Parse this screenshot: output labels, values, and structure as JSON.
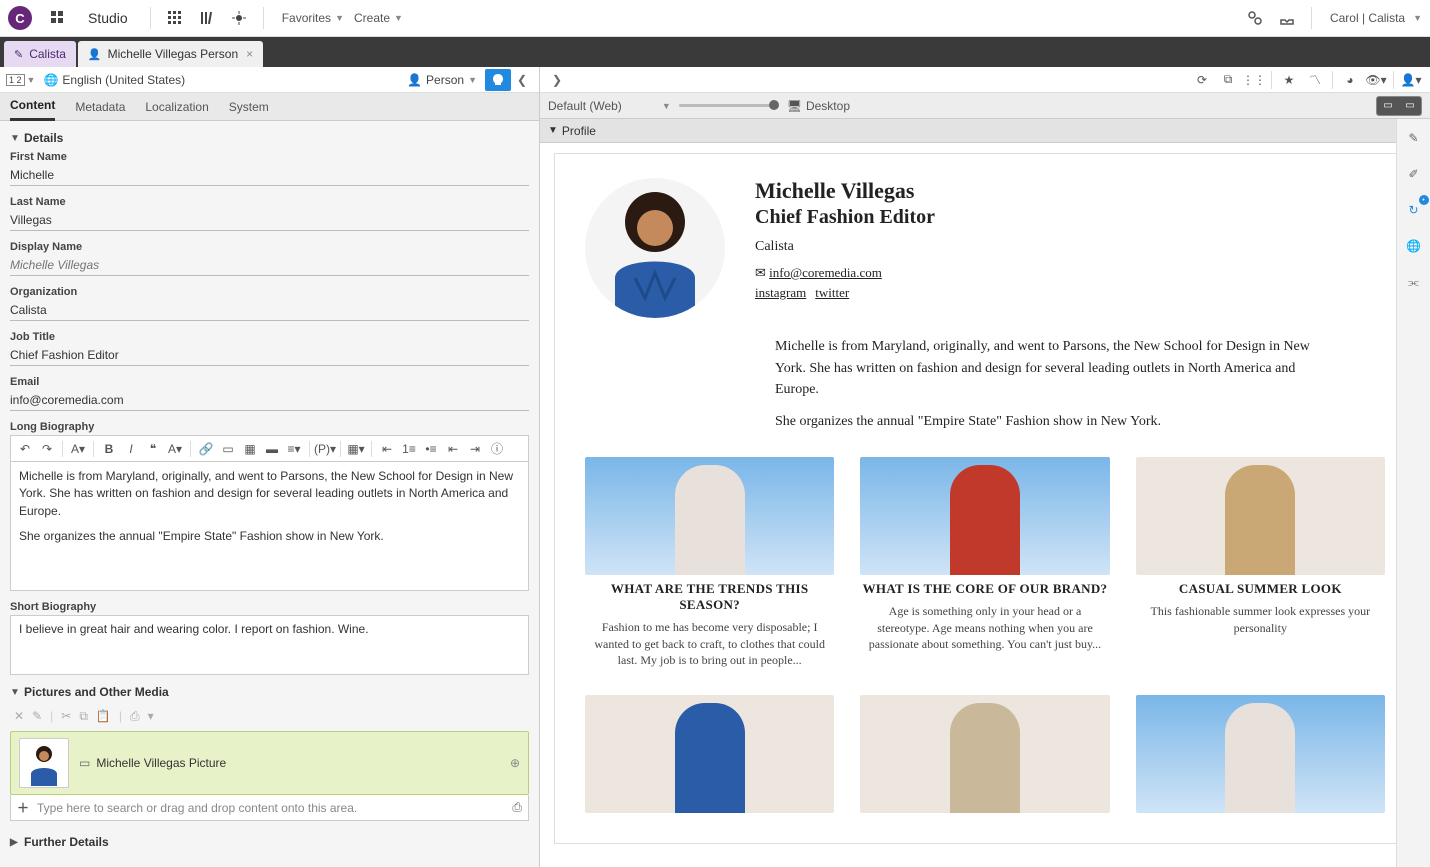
{
  "topbar": {
    "app_title": "Studio",
    "favorites_label": "Favorites",
    "create_label": "Create",
    "user_label": "Carol | Calista"
  },
  "tabs": {
    "site": "Calista",
    "doc": "Michelle Villegas Person"
  },
  "left_toolbar": {
    "locale": "English (United States)",
    "type": "Person"
  },
  "subtabs": [
    "Content",
    "Metadata",
    "Localization",
    "System"
  ],
  "sections": {
    "details": "Details",
    "pictures": "Pictures and Other Media",
    "further": "Further Details"
  },
  "fields": {
    "first_name": {
      "label": "First Name",
      "value": "Michelle"
    },
    "last_name": {
      "label": "Last Name",
      "value": "Villegas"
    },
    "display_name": {
      "label": "Display Name",
      "placeholder": "Michelle Villegas"
    },
    "organization": {
      "label": "Organization",
      "value": "Calista"
    },
    "job_title": {
      "label": "Job Title",
      "value": "Chief Fashion Editor"
    },
    "email": {
      "label": "Email",
      "value": "info@coremedia.com"
    },
    "long_bio": {
      "label": "Long Biography",
      "p1": "Michelle is from Maryland, originally, and went to Parsons, the New School for Design in New York. She has written on fashion and design for several leading outlets in North America and Europe.",
      "p2": "She organizes the annual \"Empire State\" Fashion show in New York."
    },
    "short_bio": {
      "label": "Short Biography",
      "value": "I believe in great hair and wearing color. I report on fashion. Wine."
    }
  },
  "media": {
    "item_label": "Michelle Villegas Picture",
    "drop_hint": "Type here to search or drag and drop content onto this area."
  },
  "preview_strip": {
    "channel": "Default (Web)",
    "device": "Desktop"
  },
  "profile_section": "Profile",
  "preview": {
    "name": "Michelle Villegas",
    "title": "Chief Fashion Editor",
    "org": "Calista",
    "email": "info@coremedia.com",
    "social": {
      "instagram": "instagram",
      "twitter": "twitter"
    },
    "bio_p1": "Michelle is from Maryland, originally, and went to Parsons, the New School for Design in New York. She has written on fashion and design for several leading outlets in North America and Europe.",
    "bio_p2": "She organizes the annual \"Empire State\" Fashion show in New York."
  },
  "articles": [
    {
      "title": "WHAT ARE THE TRENDS THIS SEASON?",
      "desc": "Fashion to me has become very disposable; I wanted to get back to craft, to clothes that could last. My job is to bring out in people..."
    },
    {
      "title": "WHAT IS THE CORE OF OUR BRAND?",
      "desc": "Age is something only in your head or a stereotype. Age means nothing when you are passionate about something. You can't just buy..."
    },
    {
      "title": "CASUAL SUMMER LOOK",
      "desc": "This fashionable summer look expresses your personality"
    },
    {
      "title": "",
      "desc": ""
    },
    {
      "title": "",
      "desc": ""
    },
    {
      "title": "",
      "desc": ""
    }
  ]
}
